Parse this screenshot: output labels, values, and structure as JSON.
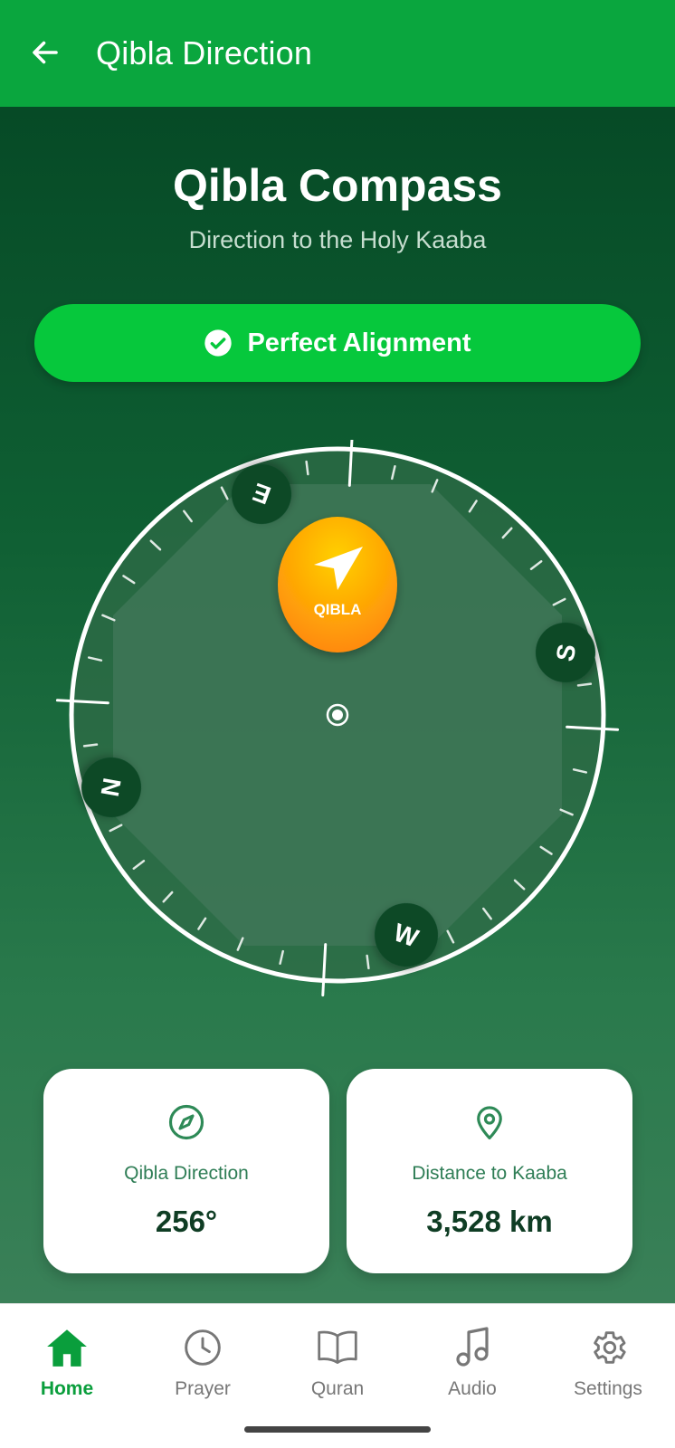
{
  "app_bar": {
    "title": "Qibla Direction"
  },
  "header": {
    "title": "Qibla Compass",
    "subtitle": "Direction to the Holy Kaaba"
  },
  "status": {
    "label": "Perfect Alignment"
  },
  "compass": {
    "qibla_label": "QIBLA",
    "cardinals": {
      "north": "N",
      "east": "E",
      "south": "S",
      "west": "W"
    }
  },
  "cards": {
    "direction": {
      "label": "Qibla Direction",
      "value": "256°"
    },
    "distance": {
      "label": "Distance to Kaaba",
      "value": "3,528 km"
    }
  },
  "nav": {
    "items": [
      {
        "label": "Home",
        "icon": "home-icon",
        "active": true
      },
      {
        "label": "Prayer",
        "icon": "clock-icon",
        "active": false
      },
      {
        "label": "Quran",
        "icon": "book-icon",
        "active": false
      },
      {
        "label": "Audio",
        "icon": "music-note-icon",
        "active": false
      },
      {
        "label": "Settings",
        "icon": "gear-icon",
        "active": false
      }
    ]
  },
  "colors": {
    "brand_green": "#0aa63e",
    "pill_green": "#06c83c",
    "qibla_orange": "#ff9f0a",
    "dark_green": "#0f3d24"
  }
}
